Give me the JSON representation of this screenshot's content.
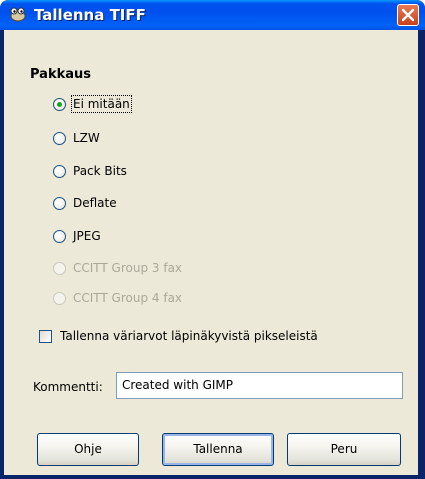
{
  "window": {
    "title": "Tallenna TIFF"
  },
  "compression": {
    "title": "Pakkaus",
    "options": [
      {
        "label": "Ei mitään",
        "checked": true,
        "disabled": false
      },
      {
        "label": "LZW",
        "checked": false,
        "disabled": false
      },
      {
        "label": "Pack Bits",
        "checked": false,
        "disabled": false
      },
      {
        "label": "Deflate",
        "checked": false,
        "disabled": false
      },
      {
        "label": "JPEG",
        "checked": false,
        "disabled": false
      },
      {
        "label": "CCITT Group 3 fax",
        "checked": false,
        "disabled": true
      },
      {
        "label": "CCITT Group 4 fax",
        "checked": false,
        "disabled": true
      }
    ]
  },
  "save_transparent": {
    "label": "Tallenna väriarvot läpinäkyvistä pikseleistä",
    "checked": false
  },
  "comment": {
    "label": "Kommentti:",
    "value": "Created with GIMP"
  },
  "buttons": {
    "help": "Ohje",
    "save": "Tallenna",
    "cancel": "Peru"
  }
}
